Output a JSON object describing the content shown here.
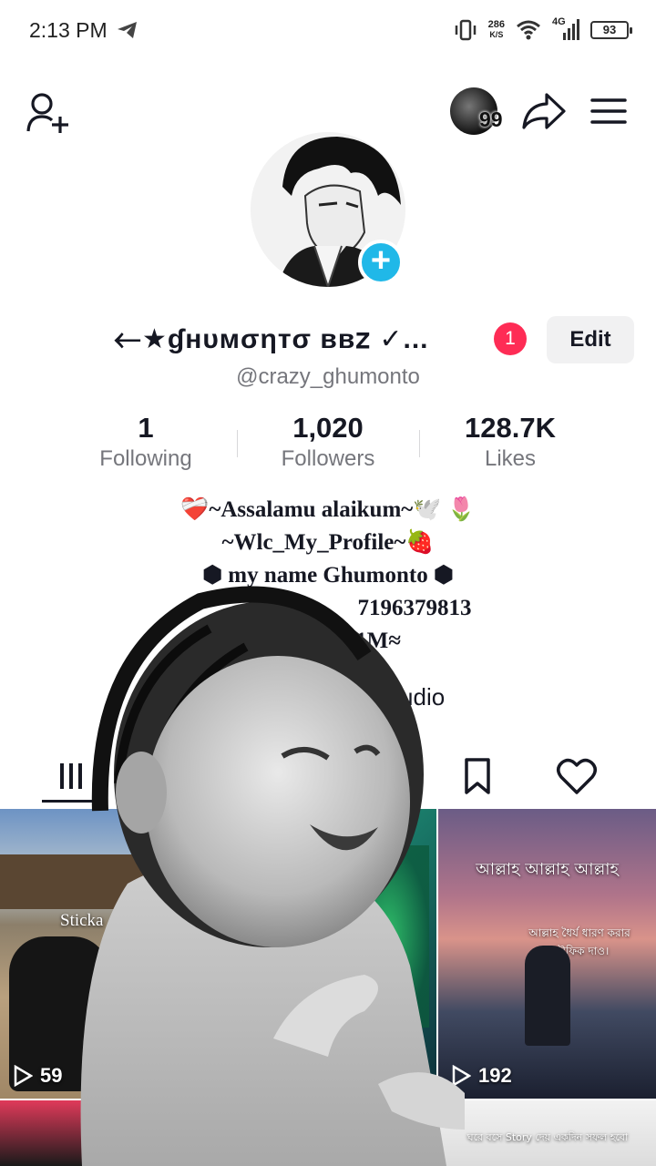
{
  "status_bar": {
    "time": "2:13 PM",
    "net_speed_value": "286",
    "net_speed_unit": "K/S",
    "network": "4G",
    "battery": "93"
  },
  "topnav": {
    "notification_count": "99"
  },
  "profile": {
    "display_name": "⃪⃪★ɠнυмσηтσ вв𝗓 ✓...",
    "name_badge": "1",
    "edit_label": "Edit",
    "username": "@crazy_ghumonto"
  },
  "stats": [
    {
      "value": "1",
      "label": "Following"
    },
    {
      "value": "1,020",
      "label": "Followers"
    },
    {
      "value": "128.7K",
      "label": "Likes"
    }
  ],
  "bio": {
    "line1": "❤️‍🩹~Assalamu alaikum~🕊️ 🌷",
    "line2": "~Wlc_My_Profile~🍓",
    "line3": "⬢ my name Ghumonto ⬢",
    "line4": "7196379813",
    "line5": "n 1M≈",
    "studio": "tudio"
  },
  "tabs": [
    "videos-tab",
    "reposts-tab",
    "saved-tab",
    "liked-tab"
  ],
  "videos": [
    {
      "count": "59",
      "caption": "Sticka"
    },
    {
      "count": "",
      "caption": ""
    },
    {
      "count": "192",
      "caption_top": "আল্লাহ আল্লাহ আল্লাহ",
      "caption_mid": "আল্লাহ ধৈর্য ধারণ করার তৌফিক দাও।"
    },
    {
      "caption_bottom": "ঘরে বসে Story দেয় একদিন সফল হবো"
    }
  ],
  "colors": {
    "accent": "#fe2c55",
    "plus_badge": "#20b8e8",
    "text_primary": "#161823",
    "text_secondary": "#75767c"
  }
}
